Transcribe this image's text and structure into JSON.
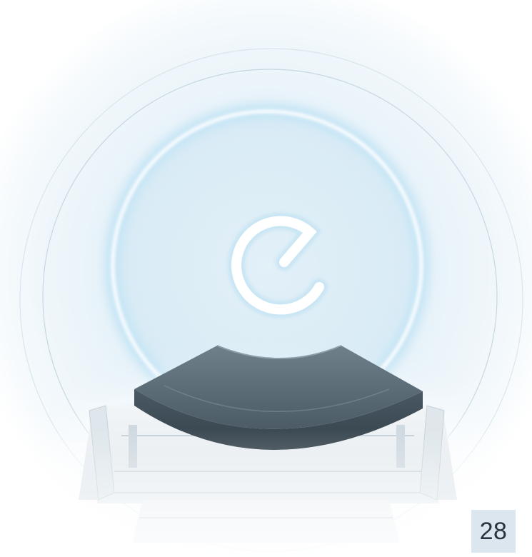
{
  "image": {
    "subject": "mri-scanner-bore-with-patient-table",
    "logo": "e",
    "colors": {
      "background": "#f7fbfd",
      "bore_glow": "#e3f1f9",
      "ring_light": "#ffffff",
      "cushion_top": "#5e6f7b",
      "cushion_side": "#3f4e58",
      "table": "#eef2f5"
    }
  },
  "page_number": {
    "value": "28",
    "background": "#dce6ee"
  }
}
